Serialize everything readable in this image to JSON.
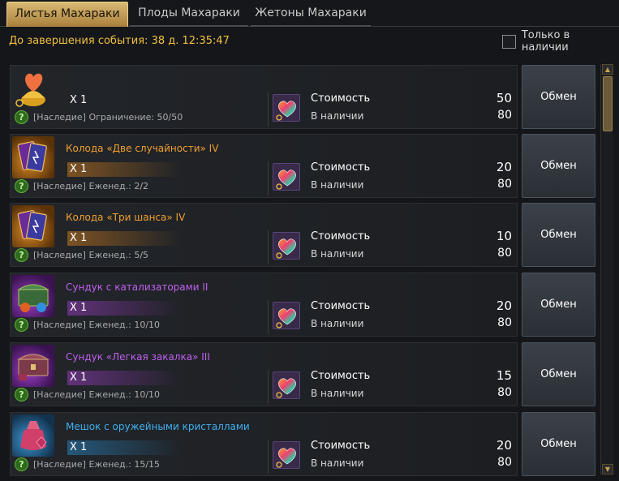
{
  "tabs": [
    {
      "label": "Листья Махараки",
      "active": true
    },
    {
      "label": "Плоды Махараки",
      "active": false
    },
    {
      "label": "Жетоны Махараки",
      "active": false
    }
  ],
  "timer": {
    "label": "До завершения события:",
    "value": "38 д. 12:35:47"
  },
  "filter": {
    "label": "Только в наличии",
    "checked": false
  },
  "colors": {
    "orange": "#f0a030",
    "purple": "#c060f0",
    "blue": "#40b0f0",
    "timer": "#f0c040"
  },
  "items": [
    {
      "name": "",
      "name_color": "",
      "quantity": "X 1",
      "limit": "[Наследие] Ограничение: 50/50",
      "cost_label": "Стоимость",
      "cost": "50",
      "stock_label": "В наличии",
      "stock": "80",
      "button": "Обмен",
      "icon": "maharaka-leaf-bag-icon",
      "grade": "plain"
    },
    {
      "name": "Колода «Две случайности» IV",
      "name_color": "#f0a030",
      "quantity": "X 1",
      "limit": "[Наследие] Еженед.: 2/2",
      "cost_label": "Стоимость",
      "cost": "20",
      "stock_label": "В наличии",
      "stock": "80",
      "button": "Обмен",
      "icon": "card-deck-icon",
      "grade": "orange"
    },
    {
      "name": "Колода «Три шанса» IV",
      "name_color": "#f0a030",
      "quantity": "X 1",
      "limit": "[Наследие] Еженед.: 5/5",
      "cost_label": "Стоимость",
      "cost": "10",
      "stock_label": "В наличии",
      "stock": "80",
      "button": "Обмен",
      "icon": "card-deck-icon",
      "grade": "orange"
    },
    {
      "name": "Сундук с катализаторами II",
      "name_color": "#c060f0",
      "quantity": "X 1",
      "limit": "[Наследие] Еженед.: 10/10",
      "cost_label": "Стоимость",
      "cost": "20",
      "stock_label": "В наличии",
      "stock": "80",
      "button": "Обмен",
      "icon": "green-chest-icon",
      "grade": "purple"
    },
    {
      "name": "Сундук «Легкая закалка» III",
      "name_color": "#c060f0",
      "quantity": "X 1",
      "limit": "[Наследие] Еженед.: 10/10",
      "cost_label": "Стоимость",
      "cost": "15",
      "stock_label": "В наличии",
      "stock": "80",
      "button": "Обмен",
      "icon": "red-chest-icon",
      "grade": "purple"
    },
    {
      "name": "Мешок с оружейными кристаллами",
      "name_color": "#40b0f0",
      "quantity": "X 1",
      "limit": "[Наследие] Еженед.: 15/15",
      "cost_label": "Стоимость",
      "cost": "20",
      "stock_label": "В наличии",
      "stock": "80",
      "button": "Обмен",
      "icon": "crystal-pouch-icon",
      "grade": "blue"
    }
  ]
}
